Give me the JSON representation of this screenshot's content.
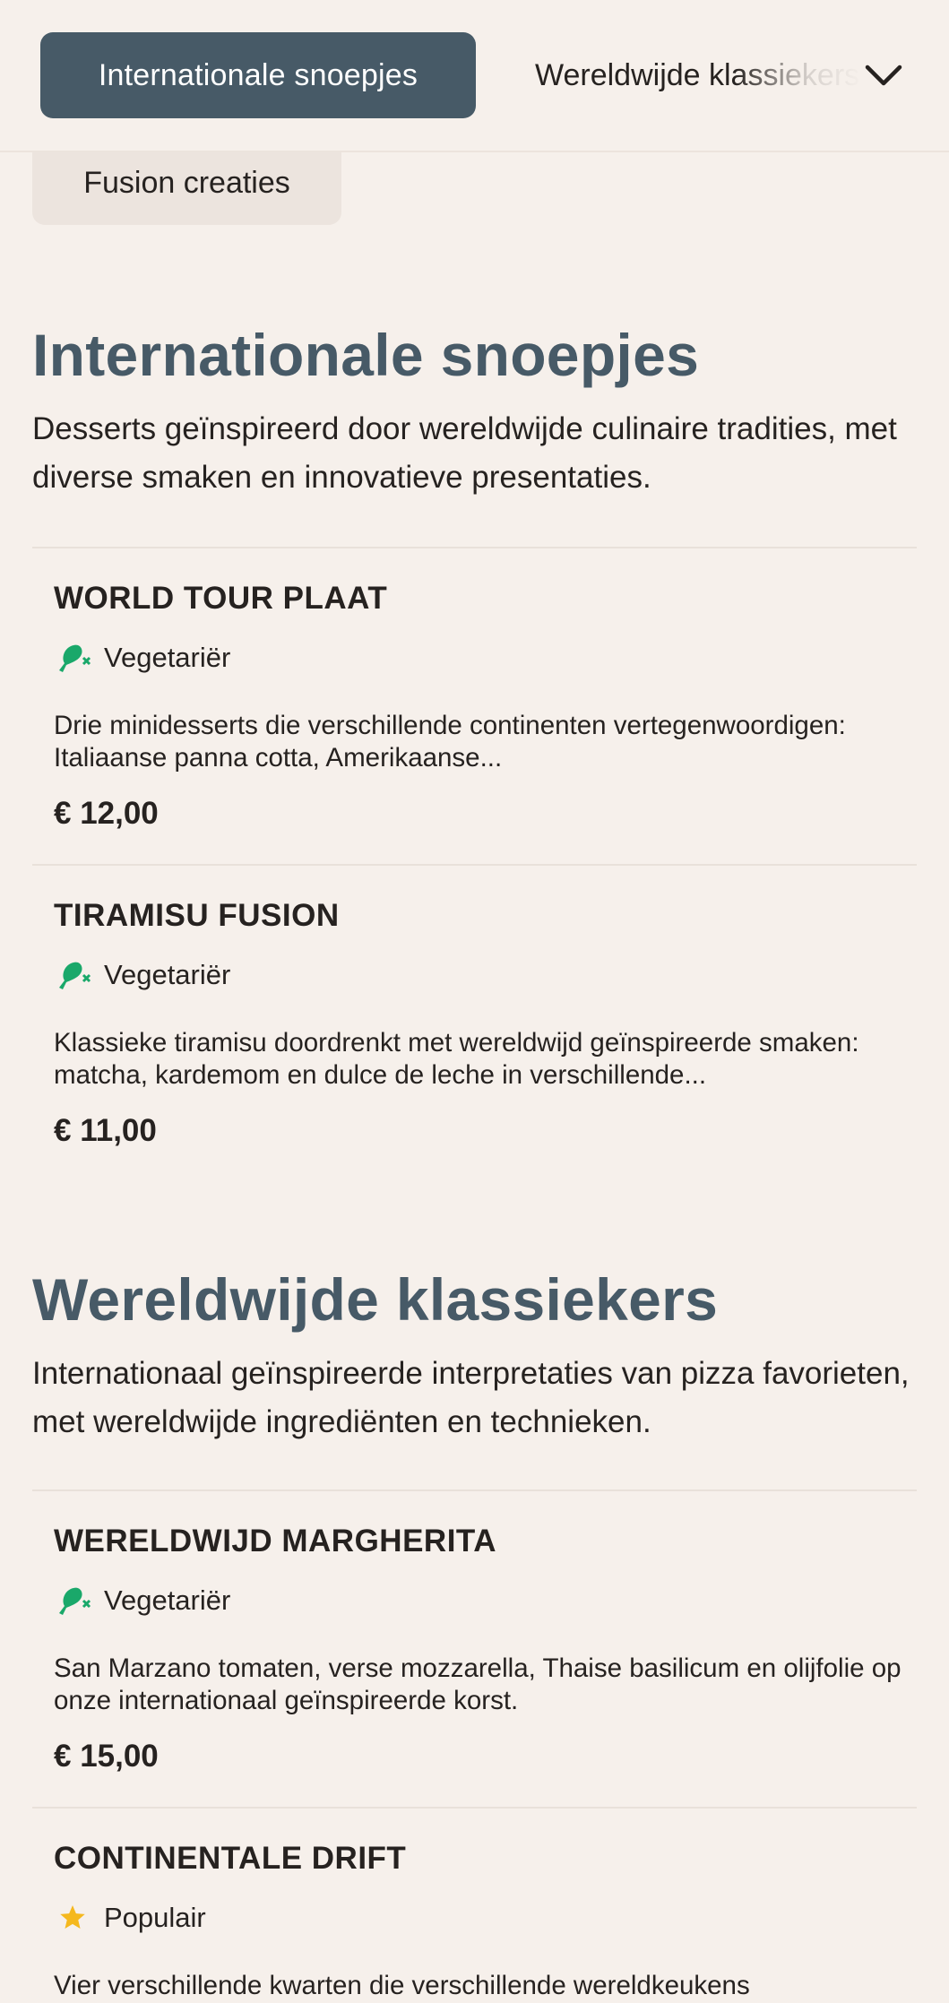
{
  "category_bar": {
    "active_label": "Internationale snoepjes",
    "next_label": "Wereldwijde klassiekers",
    "overflow_label": "Fusion creaties"
  },
  "sections": [
    {
      "title": "Internationale snoepjes",
      "description": "Desserts geïnspireerd door wereldwijde culinaire tradities, met diverse smaken en innovatieve presentaties.",
      "items": [
        {
          "name": "WORLD TOUR PLAAT",
          "tag": "Vegetariër",
          "tag_icon": "vegetarian-drumstick-icon",
          "description": "Drie minidesserts die verschillende continenten vertegenwoordigen: Italiaanse panna cotta, Amerikaanse...",
          "price": "€ 12,00"
        },
        {
          "name": "TIRAMISU FUSION",
          "tag": "Vegetariër",
          "tag_icon": "vegetarian-drumstick-icon",
          "description": "Klassieke tiramisu doordrenkt met wereldwijd geïnspireerde smaken: matcha, kardemom en dulce de leche in verschillende...",
          "price": "€ 11,00"
        }
      ]
    },
    {
      "title": "Wereldwijde klassiekers",
      "description": "Internationaal geïnspireerde interpretaties van pizza favorieten, met wereldwijde ingrediënten en technieken.",
      "items": [
        {
          "name": "WERELDWIJD MARGHERITA",
          "tag": "Vegetariër",
          "tag_icon": "vegetarian-drumstick-icon",
          "description": "San Marzano tomaten, verse mozzarella, Thaise basilicum en olijfolie op onze internationaal geïnspireerde korst.",
          "price": "€ 15,00"
        },
        {
          "name": "CONTINENTALE DRIFT",
          "tag": "Populair",
          "tag_icon": "star-icon",
          "description": "Vier verschillende kwarten die verschillende wereldkeukens",
          "price": ""
        }
      ]
    }
  ],
  "colors": {
    "background": "#f6f0eb",
    "accent": "#475a67",
    "vegetarian_green": "#1aa86a",
    "star_yellow": "#f5b81e"
  }
}
